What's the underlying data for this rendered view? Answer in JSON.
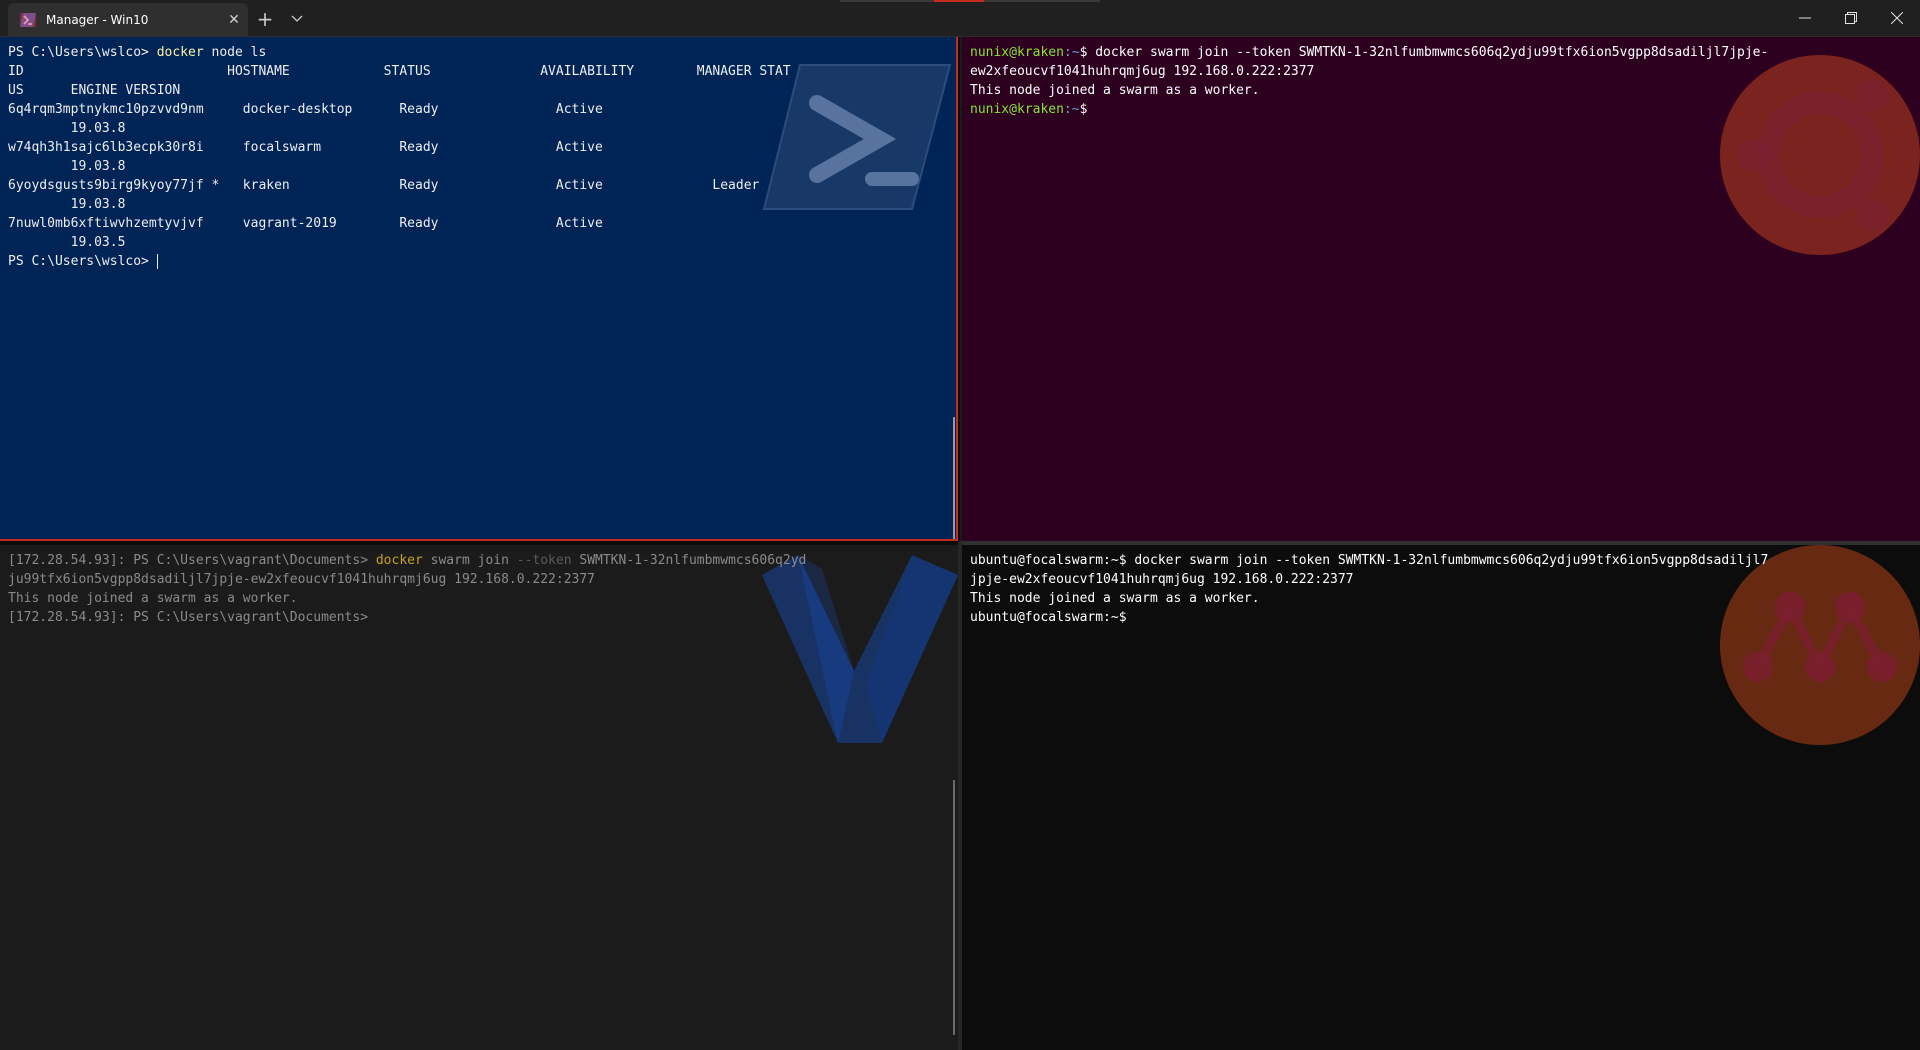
{
  "titlebar": {
    "tab_title": "Manager - Win10",
    "tab_close": "✕",
    "new_tab": "+",
    "dropdown": "⌄",
    "minimize": "—",
    "maximize": "❐",
    "close": "✕"
  },
  "panes": {
    "top_left": {
      "shell": "PowerShell",
      "lines": [
        {
          "prompt": "PS C:\\Users\\wslco> ",
          "cmd": "docker",
          "rest": " node ls"
        },
        {
          "text": "ID                          HOSTNAME            STATUS              AVAILABILITY        MANAGER STAT"
        },
        {
          "text": "US      ENGINE VERSION"
        },
        {
          "text": "6q4rqm3mptnykmc10pzvvd9nm     docker-desktop      Ready               Active"
        },
        {
          "text": "        19.03.8"
        },
        {
          "text": "w74qh3h1sajc6lb3ecpk30r8i     focalswarm          Ready               Active"
        },
        {
          "text": "        19.03.8"
        },
        {
          "text": "6yoydsgusts9birg9kyoy77jf *   kraken              Ready               Active              Leader"
        },
        {
          "text": "        19.03.8"
        },
        {
          "text": "7nuwl0mb6xftiwvhzemtyvjvf     vagrant-2019        Ready               Active"
        },
        {
          "text": "        19.03.5"
        },
        {
          "prompt": "PS C:\\Users\\wslco> ",
          "cursor": true
        }
      ]
    },
    "top_right": {
      "shell": "Ubuntu",
      "user_host": "nunix@kraken",
      "path": ":~",
      "lines": [
        {
          "prompt_user": "nunix@kraken",
          "prompt_path": ":~",
          "prompt_sym": "$ ",
          "text": "docker swarm join --token SWMTKN-1-32nlfumbmwmcs606q2ydju99tfx6ion5vgpp8dsadiljl7jpje-"
        },
        {
          "text": "ew2xfeoucvf1041huhrqmj6ug 192.168.0.222:2377"
        },
        {
          "text": "This node joined a swarm as a worker."
        },
        {
          "prompt_user": "nunix@kraken",
          "prompt_path": ":~",
          "prompt_sym": "$",
          "text": ""
        }
      ]
    },
    "bottom_left": {
      "shell": "PowerShell (Vagrant remote)",
      "lines": [
        {
          "prefix": "[172.28.54.93]: PS C:\\Users\\vagrant\\Documents> ",
          "cmd": "docker",
          "mid": " swarm join ",
          "flag": "--token",
          "rest": " SWMTKN-1-32nlfumbmwmcs606q2yd"
        },
        {
          "text": "ju99tfx6ion5vgpp8dsadiljl7jpje-ew2xfeoucvf1041huhrqmj6ug 192.168.0.222:2377"
        },
        {
          "text": "This node joined a swarm as a worker."
        },
        {
          "text": "[172.28.54.93]: PS C:\\Users\\vagrant\\Documents>"
        }
      ]
    },
    "bottom_right": {
      "shell": "Ubuntu (focalswarm)",
      "lines": [
        {
          "text": "ubuntu@focalswarm:~$ docker swarm join --token SWMTKN-1-32nlfumbmwmcs606q2ydju99tfx6ion5vgpp8dsadiljl7"
        },
        {
          "text": "jpje-ew2xfeoucvf1041huhrqmj6ug 192.168.0.222:2377"
        },
        {
          "text": "This node joined a swarm as a worker."
        },
        {
          "text": "ubuntu@focalswarm:~$"
        }
      ]
    }
  },
  "colors": {
    "powershell_bg": "#012456",
    "ubuntu_bg": "#2c001e",
    "vagrant_bg": "#1b1b1b",
    "black_bg": "#0c0c0c",
    "focus_border": "#c42b1c",
    "ubuntu_logo": "#e95420",
    "vagrant_logo": "#1563ff"
  },
  "icons": [
    "powershell-icon",
    "close-icon",
    "plus-icon",
    "chevron-down-icon",
    "minimize-icon",
    "maximize-icon",
    "window-close-icon",
    "powershell-logo",
    "ubuntu-logo",
    "vagrant-logo",
    "multipass-logo"
  ]
}
